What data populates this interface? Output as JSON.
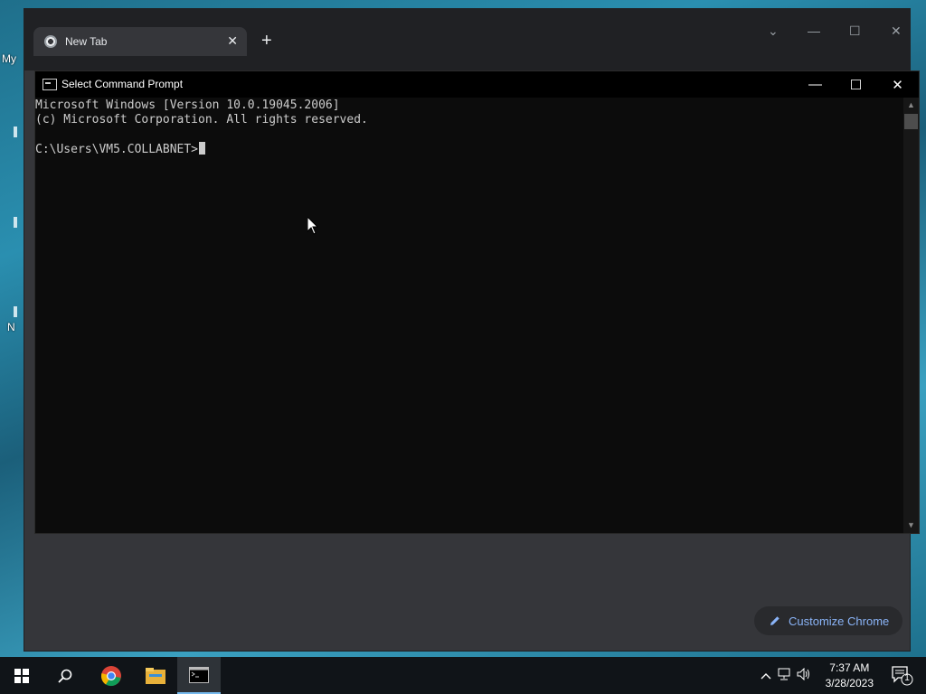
{
  "desktop": {
    "label_top": "My",
    "label_mid": "N"
  },
  "chrome": {
    "tab_title": "New Tab",
    "tab_close": "✕",
    "new_tab": "+",
    "customize_label": "Customize Chrome",
    "controls": [
      "⌄",
      "—",
      "☐",
      "✕"
    ]
  },
  "cmd": {
    "title": "Select Command Prompt",
    "lines": [
      "Microsoft Windows [Version 10.0.19045.2006]",
      "(c) Microsoft Corporation. All rights reserved.",
      "",
      "C:\\Users\\VM5.COLLABNET>"
    ],
    "minimize": "—",
    "maximize": "☐",
    "close": "✕"
  },
  "taskbar": {
    "time": "7:37 AM",
    "date": "3/28/2023",
    "notification_count": "1",
    "apps": [
      "start-icon",
      "search-icon",
      "chrome-icon",
      "file-explorer-icon",
      "command-prompt-icon"
    ]
  },
  "colors": {
    "console_bg": "#0c0c0c",
    "console_text": "#cccccc",
    "chrome_bg": "#35363a",
    "accent": "#8ab4f8"
  }
}
